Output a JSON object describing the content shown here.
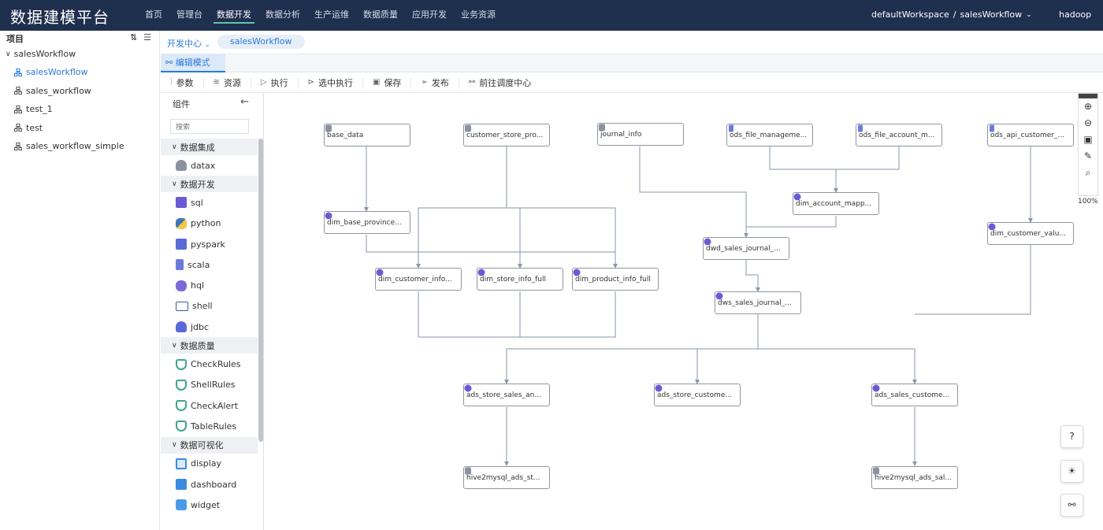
{
  "app": {
    "title": "数据建模平台"
  },
  "nav": [
    "首页",
    "管理台",
    "数据开发",
    "数据分析",
    "生产运维",
    "数据质量",
    "应用开发",
    "业务资源"
  ],
  "workspace": {
    "name": "defaultWorkspace",
    "sep": "/",
    "workflow": "salesWorkflow"
  },
  "user": "hadoop",
  "project": {
    "header": "项目",
    "root": "salesWorkflow",
    "items": [
      "salesWorkflow",
      "sales_workflow",
      "test_1",
      "test",
      "sales_workflow_simple"
    ]
  },
  "subbar": {
    "devcenter": "开发中心",
    "tab": "salesWorkflow"
  },
  "mode": "编辑模式",
  "toolbar": [
    "参数",
    "资源",
    "执行",
    "选中执行",
    "保存",
    "发布",
    "前往调度中心"
  ],
  "components": {
    "header": "组件",
    "search_placeholder": "搜索",
    "groups": [
      {
        "name": "数据集成",
        "items": [
          "datax"
        ]
      },
      {
        "name": "数据开发",
        "items": [
          "sql",
          "python",
          "pyspark",
          "scala",
          "hql",
          "shell",
          "jdbc"
        ]
      },
      {
        "name": "数据质量",
        "items": [
          "CheckRules",
          "ShellRules",
          "CheckAlert",
          "TableRules"
        ]
      },
      {
        "name": "数据可视化",
        "items": [
          "display",
          "dashboard",
          "widget"
        ]
      }
    ]
  },
  "nodes": [
    "base_data",
    "customer_store_pro...",
    "journal_info",
    "ods_file_manageme...",
    "ods_file_account_m...",
    "ods_api_customer_...",
    "dim_base_province...",
    "dim_account_mapp...",
    "dwd_sales_journal_...",
    "dim_customer_valu...",
    "dim_customer_info...",
    "dim_store_info_full",
    "dim_product_info_full",
    "dws_sales_journal_...",
    "ads_store_sales_an...",
    "ads_store_custome...",
    "ads_sales_custome...",
    "hive2mysql_ads_st...",
    "hive2mysql_ads_sal..."
  ],
  "zoom": "100%",
  "colors": {
    "topbar": "#1f2f4e",
    "accent": "#2b7ad8",
    "node_border": "#8f96a1",
    "edge": "#8a96a8"
  }
}
